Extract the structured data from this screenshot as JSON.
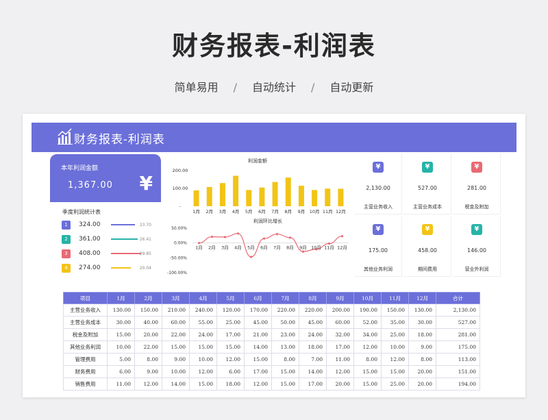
{
  "hero": {
    "title": "财务报表-利润表",
    "features": [
      "简单易用",
      "自动统计",
      "自动更新"
    ],
    "sep": "/"
  },
  "banner": {
    "title": "财务报表-利润表"
  },
  "annual": {
    "label": "本年利润金额",
    "value": "1,367.00",
    "currency": "¥"
  },
  "quarterly": {
    "title": "季度利润统计表",
    "rows": [
      {
        "num": "1",
        "value": "324.00",
        "pct": "23.70",
        "color": "#6b6fd9"
      },
      {
        "num": "2",
        "value": "361.00",
        "pct": "26.41",
        "color": "#26b3a8"
      },
      {
        "num": "3",
        "value": "408.00",
        "pct": "29.85",
        "color": "#e86a74"
      },
      {
        "num": "4",
        "value": "274.00",
        "pct": "20.04",
        "color": "#f2c417"
      }
    ]
  },
  "chart_data": [
    {
      "type": "bar",
      "title": "利润金额",
      "categories": [
        "1月",
        "2月",
        "3月",
        "4月",
        "5月",
        "6月",
        "7月",
        "8月",
        "9月",
        "10月",
        "11月",
        "12月"
      ],
      "values": [
        89,
        108,
        130,
        171,
        91,
        105,
        136,
        161,
        115,
        91,
        99,
        98
      ],
      "yticks": [
        "200.00",
        "100.00",
        "-"
      ],
      "ylim": [
        0,
        200
      ],
      "color": "#f2c417"
    },
    {
      "type": "line",
      "title": "利润环比增长",
      "categories": [
        "1月",
        "2月",
        "3月",
        "4月",
        "5月",
        "6月",
        "7月",
        "8月",
        "9月",
        "10月",
        "11月",
        "12月"
      ],
      "values": [
        0,
        21,
        20,
        32,
        -47,
        15,
        30,
        18,
        -29,
        -21,
        -2,
        23
      ],
      "yticks": [
        "50.00%",
        "0.00%",
        "-50.00%",
        "-100.00%"
      ],
      "ylim": [
        -100,
        50
      ],
      "color": "#e86a74"
    }
  ],
  "cards": [
    {
      "value": "2,130.00",
      "label": "主营业务收入",
      "color": "#6b6fd9"
    },
    {
      "value": "527.00",
      "label": "主营业务成本",
      "color": "#26b3a8"
    },
    {
      "value": "281.00",
      "label": "税金及附加",
      "color": "#e86a74"
    },
    {
      "value": "175.00",
      "label": "其他业务利润",
      "color": "#6b6fd9"
    },
    {
      "value": "458.00",
      "label": "期间费用",
      "color": "#f2c417"
    },
    {
      "value": "146.00",
      "label": "营业外利润",
      "color": "#26b3a8"
    }
  ],
  "table": {
    "headers": [
      "项目",
      "1月",
      "2月",
      "3月",
      "4月",
      "5月",
      "6月",
      "7月",
      "8月",
      "9月",
      "10月",
      "11月",
      "12月",
      "合计"
    ],
    "rows": [
      [
        "主营业务收入",
        "130.00",
        "150.00",
        "210.00",
        "240.00",
        "120.00",
        "170.00",
        "220.00",
        "220.00",
        "200.00",
        "190.00",
        "150.00",
        "130.00",
        "2,130.00"
      ],
      [
        "主营业务成本",
        "30.00",
        "40.00",
        "60.00",
        "55.00",
        "25.00",
        "45.00",
        "50.00",
        "45.00",
        "60.00",
        "52.00",
        "35.00",
        "30.00",
        "527.00"
      ],
      [
        "税金及附加",
        "15.00",
        "20.00",
        "22.00",
        "24.00",
        "17.00",
        "21.00",
        "23.00",
        "24.00",
        "32.00",
        "34.00",
        "25.00",
        "18.00",
        "281.00"
      ],
      [
        "其他业务利润",
        "10.00",
        "22.00",
        "15.00",
        "15.00",
        "15.00",
        "14.00",
        "13.00",
        "18.00",
        "17.00",
        "12.00",
        "10.00",
        "9.00",
        "175.00"
      ],
      [
        "管理费用",
        "5.00",
        "8.00",
        "9.00",
        "10.00",
        "12.00",
        "15.00",
        "8.00",
        "7.00",
        "11.00",
        "8.00",
        "12.00",
        "8.00",
        "113.00"
      ],
      [
        "财务费用",
        "6.00",
        "9.00",
        "10.00",
        "12.00",
        "6.00",
        "17.00",
        "15.00",
        "14.00",
        "12.00",
        "15.00",
        "15.00",
        "20.00",
        "151.00"
      ],
      [
        "销售费用",
        "11.00",
        "12.00",
        "14.00",
        "15.00",
        "18.00",
        "12.00",
        "15.00",
        "17.00",
        "20.00",
        "15.00",
        "25.00",
        "20.00",
        "194.00"
      ]
    ]
  }
}
